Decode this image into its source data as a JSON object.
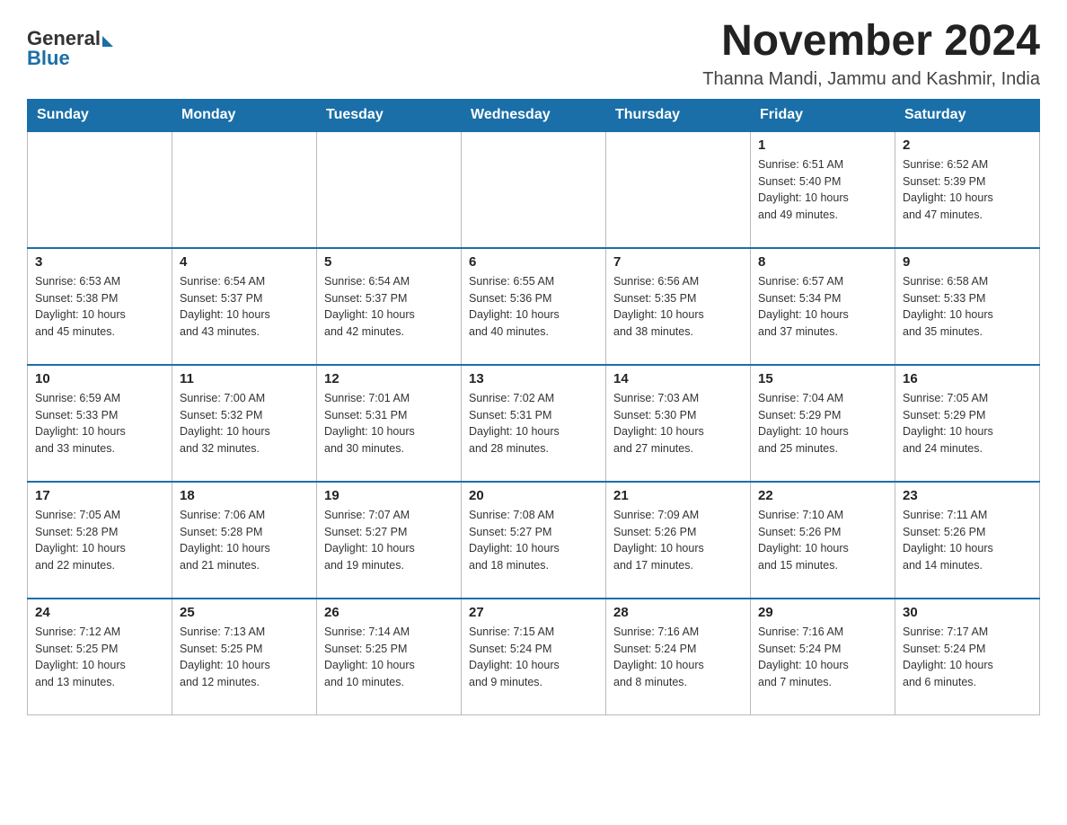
{
  "header": {
    "logo_general": "General",
    "logo_blue": "Blue",
    "title": "November 2024",
    "subtitle": "Thanna Mandi, Jammu and Kashmir, India"
  },
  "weekdays": [
    "Sunday",
    "Monday",
    "Tuesday",
    "Wednesday",
    "Thursday",
    "Friday",
    "Saturday"
  ],
  "weeks": [
    [
      {
        "day": "",
        "info": ""
      },
      {
        "day": "",
        "info": ""
      },
      {
        "day": "",
        "info": ""
      },
      {
        "day": "",
        "info": ""
      },
      {
        "day": "",
        "info": ""
      },
      {
        "day": "1",
        "info": "Sunrise: 6:51 AM\nSunset: 5:40 PM\nDaylight: 10 hours\nand 49 minutes."
      },
      {
        "day": "2",
        "info": "Sunrise: 6:52 AM\nSunset: 5:39 PM\nDaylight: 10 hours\nand 47 minutes."
      }
    ],
    [
      {
        "day": "3",
        "info": "Sunrise: 6:53 AM\nSunset: 5:38 PM\nDaylight: 10 hours\nand 45 minutes."
      },
      {
        "day": "4",
        "info": "Sunrise: 6:54 AM\nSunset: 5:37 PM\nDaylight: 10 hours\nand 43 minutes."
      },
      {
        "day": "5",
        "info": "Sunrise: 6:54 AM\nSunset: 5:37 PM\nDaylight: 10 hours\nand 42 minutes."
      },
      {
        "day": "6",
        "info": "Sunrise: 6:55 AM\nSunset: 5:36 PM\nDaylight: 10 hours\nand 40 minutes."
      },
      {
        "day": "7",
        "info": "Sunrise: 6:56 AM\nSunset: 5:35 PM\nDaylight: 10 hours\nand 38 minutes."
      },
      {
        "day": "8",
        "info": "Sunrise: 6:57 AM\nSunset: 5:34 PM\nDaylight: 10 hours\nand 37 minutes."
      },
      {
        "day": "9",
        "info": "Sunrise: 6:58 AM\nSunset: 5:33 PM\nDaylight: 10 hours\nand 35 minutes."
      }
    ],
    [
      {
        "day": "10",
        "info": "Sunrise: 6:59 AM\nSunset: 5:33 PM\nDaylight: 10 hours\nand 33 minutes."
      },
      {
        "day": "11",
        "info": "Sunrise: 7:00 AM\nSunset: 5:32 PM\nDaylight: 10 hours\nand 32 minutes."
      },
      {
        "day": "12",
        "info": "Sunrise: 7:01 AM\nSunset: 5:31 PM\nDaylight: 10 hours\nand 30 minutes."
      },
      {
        "day": "13",
        "info": "Sunrise: 7:02 AM\nSunset: 5:31 PM\nDaylight: 10 hours\nand 28 minutes."
      },
      {
        "day": "14",
        "info": "Sunrise: 7:03 AM\nSunset: 5:30 PM\nDaylight: 10 hours\nand 27 minutes."
      },
      {
        "day": "15",
        "info": "Sunrise: 7:04 AM\nSunset: 5:29 PM\nDaylight: 10 hours\nand 25 minutes."
      },
      {
        "day": "16",
        "info": "Sunrise: 7:05 AM\nSunset: 5:29 PM\nDaylight: 10 hours\nand 24 minutes."
      }
    ],
    [
      {
        "day": "17",
        "info": "Sunrise: 7:05 AM\nSunset: 5:28 PM\nDaylight: 10 hours\nand 22 minutes."
      },
      {
        "day": "18",
        "info": "Sunrise: 7:06 AM\nSunset: 5:28 PM\nDaylight: 10 hours\nand 21 minutes."
      },
      {
        "day": "19",
        "info": "Sunrise: 7:07 AM\nSunset: 5:27 PM\nDaylight: 10 hours\nand 19 minutes."
      },
      {
        "day": "20",
        "info": "Sunrise: 7:08 AM\nSunset: 5:27 PM\nDaylight: 10 hours\nand 18 minutes."
      },
      {
        "day": "21",
        "info": "Sunrise: 7:09 AM\nSunset: 5:26 PM\nDaylight: 10 hours\nand 17 minutes."
      },
      {
        "day": "22",
        "info": "Sunrise: 7:10 AM\nSunset: 5:26 PM\nDaylight: 10 hours\nand 15 minutes."
      },
      {
        "day": "23",
        "info": "Sunrise: 7:11 AM\nSunset: 5:26 PM\nDaylight: 10 hours\nand 14 minutes."
      }
    ],
    [
      {
        "day": "24",
        "info": "Sunrise: 7:12 AM\nSunset: 5:25 PM\nDaylight: 10 hours\nand 13 minutes."
      },
      {
        "day": "25",
        "info": "Sunrise: 7:13 AM\nSunset: 5:25 PM\nDaylight: 10 hours\nand 12 minutes."
      },
      {
        "day": "26",
        "info": "Sunrise: 7:14 AM\nSunset: 5:25 PM\nDaylight: 10 hours\nand 10 minutes."
      },
      {
        "day": "27",
        "info": "Sunrise: 7:15 AM\nSunset: 5:24 PM\nDaylight: 10 hours\nand 9 minutes."
      },
      {
        "day": "28",
        "info": "Sunrise: 7:16 AM\nSunset: 5:24 PM\nDaylight: 10 hours\nand 8 minutes."
      },
      {
        "day": "29",
        "info": "Sunrise: 7:16 AM\nSunset: 5:24 PM\nDaylight: 10 hours\nand 7 minutes."
      },
      {
        "day": "30",
        "info": "Sunrise: 7:17 AM\nSunset: 5:24 PM\nDaylight: 10 hours\nand 6 minutes."
      }
    ]
  ]
}
